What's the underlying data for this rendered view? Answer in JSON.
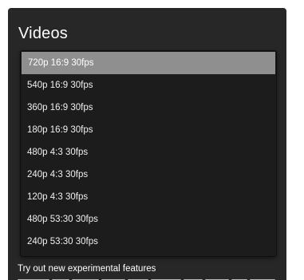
{
  "section": {
    "title": "Videos"
  },
  "dropdown": {
    "selected_index": 0,
    "options": [
      {
        "label": "720p 16:9 30fps"
      },
      {
        "label": "540p 16:9 30fps"
      },
      {
        "label": "360p 16:9 30fps"
      },
      {
        "label": "180p 16:9 30fps"
      },
      {
        "label": "480p 4:3 30fps"
      },
      {
        "label": "240p 4:3 30fps"
      },
      {
        "label": "120p 4:3 30fps"
      },
      {
        "label": "480p 53:30 30fps"
      },
      {
        "label": "240p 53:30 30fps"
      }
    ]
  },
  "experimental": {
    "label": "Try out new experimental features"
  },
  "colors": {
    "panel_bg": "#272727",
    "list_bg": "#1c1c1c",
    "selected_bg": "#8f8f8f",
    "text": "#f0f0f0"
  }
}
